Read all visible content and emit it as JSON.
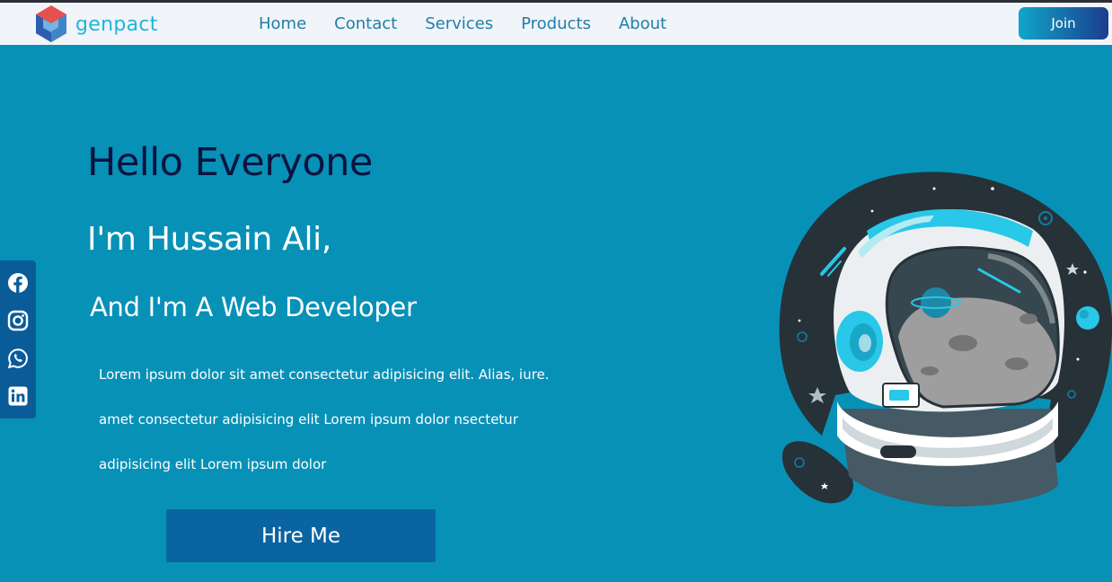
{
  "brand": {
    "name": "genpact",
    "accent": "#1fb5d9"
  },
  "nav": {
    "links": [
      {
        "label": "Home"
      },
      {
        "label": "Contact"
      },
      {
        "label": "Services"
      },
      {
        "label": "Products"
      },
      {
        "label": "About"
      }
    ],
    "join_label": "Join"
  },
  "social": {
    "icons": [
      "facebook-icon",
      "instagram-icon",
      "whatsapp-icon",
      "linkedin-icon"
    ]
  },
  "hero": {
    "greeting": "Hello Everyone",
    "name_line": "I'm Hussain Ali,",
    "role_line": "And I'm A Web Developer",
    "lines": [
      "Lorem ipsum dolor sit amet consectetur adipisicing elit. Alias, iure.",
      "amet consectetur adipisicing elit Lorem ipsum dolor nsectetur",
      "adipisicing elit Lorem ipsum dolor"
    ],
    "cta_label": "Hire Me"
  },
  "illustration": {
    "subject": "astronaut-helmet-illustration"
  },
  "colors": {
    "background": "#0891b7",
    "navbar": "#f1f4f8",
    "nav_link": "#1e7fa8",
    "heading_dark": "#0b1440",
    "button": "#0a64a2"
  }
}
